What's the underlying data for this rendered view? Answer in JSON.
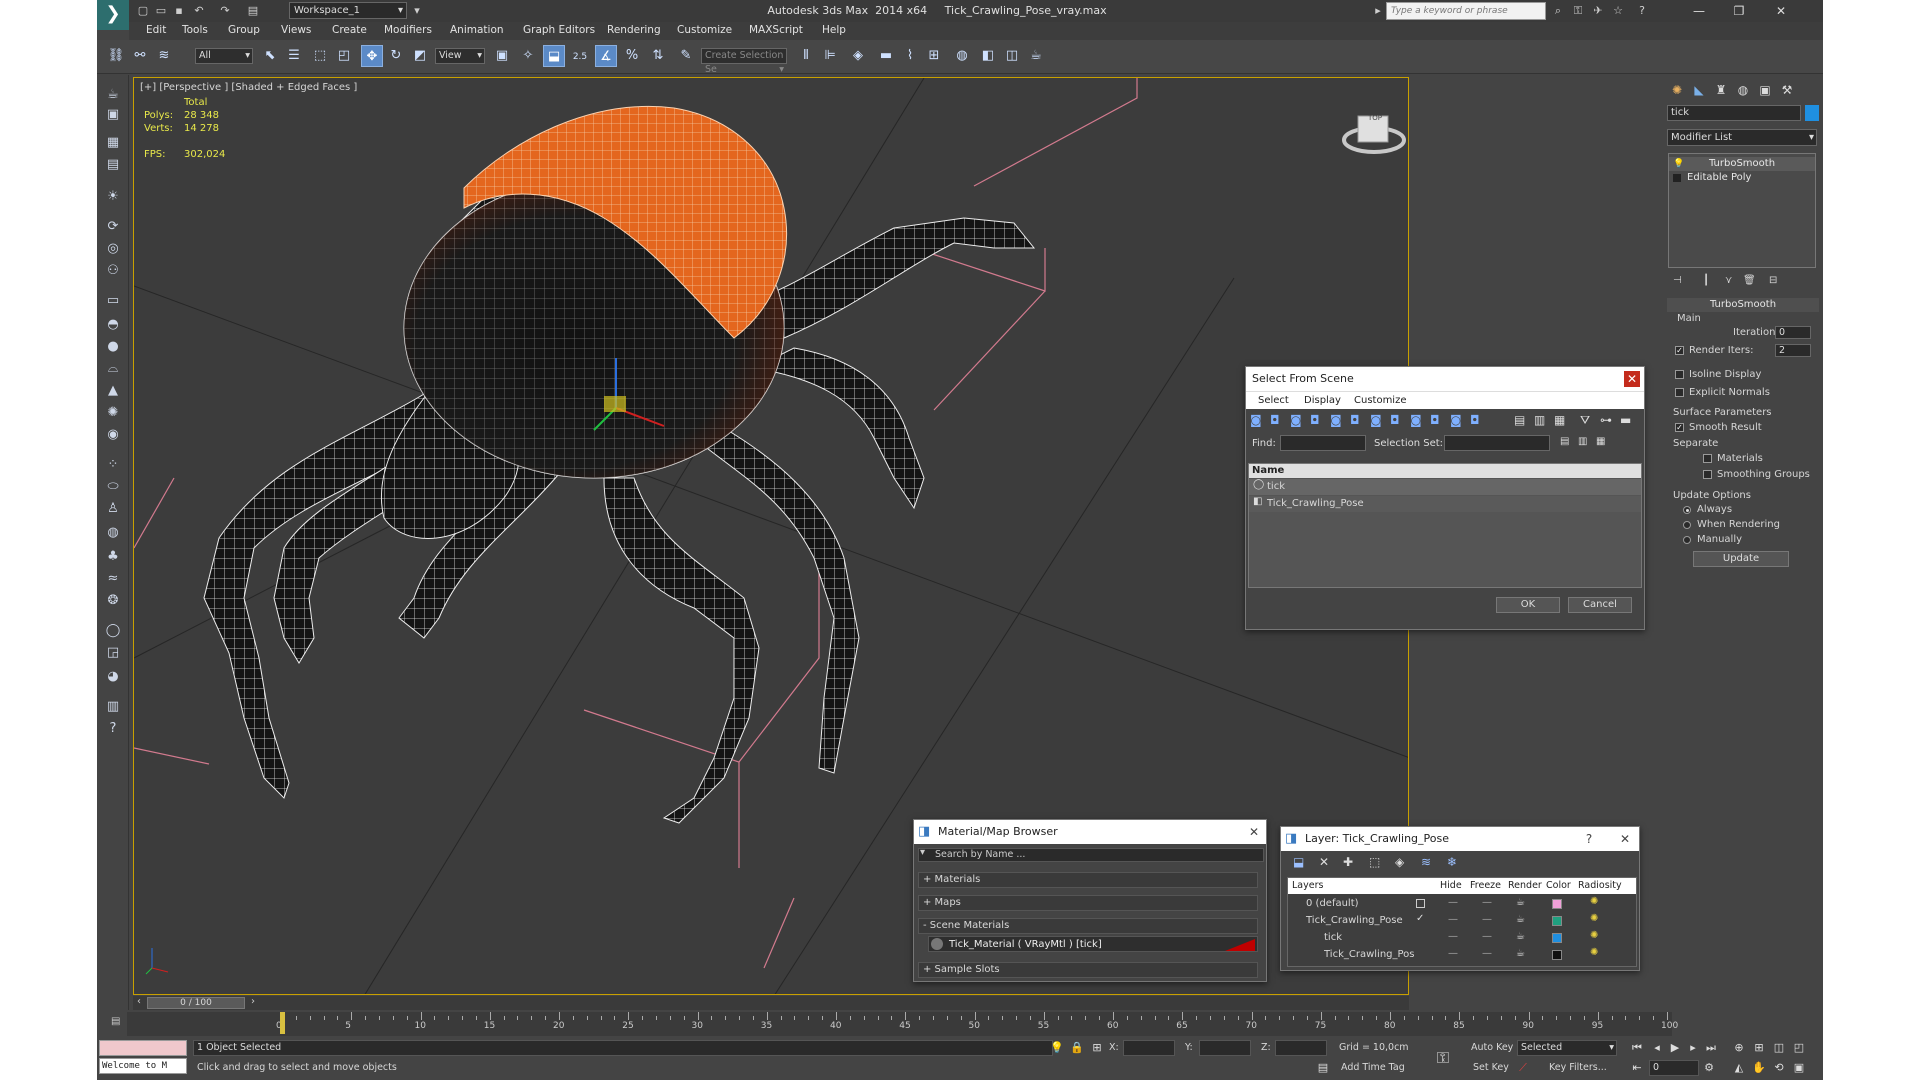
{
  "app": {
    "window_title": "Autodesk 3ds Max  2014 x64     Tick_Crawling_Pose_vray.max",
    "workspace": "Workspace_1",
    "search_placeholder": "Type a keyword or phrase"
  },
  "menu": [
    "Edit",
    "Tools",
    "Group",
    "Views",
    "Create",
    "Modifiers",
    "Animation",
    "Graph Editors",
    "Rendering",
    "Customize",
    "MAXScript",
    "Help"
  ],
  "toolbar": {
    "selection_filter": "All",
    "reference_coord": "View",
    "snap_value": "2.5",
    "named_selection_placeholder": "Create Selection Se"
  },
  "viewport": {
    "label": "[+] [Perspective ] [Shaded + Edged Faces ]",
    "stats": {
      "total_label": "Total",
      "polys_label": "Polys:",
      "polys_value": "28 348",
      "verts_label": "Verts:",
      "verts_value": "14 278",
      "fps_label": "FPS:",
      "fps_value": "302,024"
    },
    "viewcube_text": "TOP"
  },
  "command_panel": {
    "object_name": "tick",
    "object_color": "#1f8fe0",
    "modifier_list": "Modifier List",
    "stack": [
      "TurboSmooth",
      "Editable Poly"
    ],
    "turbosmooth": {
      "title": "TurboSmooth",
      "main": "Main",
      "iterations_label": "Iterations:",
      "iterations_value": "0",
      "render_iters_label": "Render Iters:",
      "render_iters_value": "2",
      "isoline": "Isoline Display",
      "explicit_normals": "Explicit Normals",
      "surface_params": "Surface Parameters",
      "smooth_result": "Smooth Result",
      "separate": "Separate",
      "materials": "Materials",
      "smoothing_groups": "Smoothing Groups",
      "update_options": "Update Options",
      "always": "Always",
      "when_rendering": "When Rendering",
      "manually": "Manually",
      "update_btn": "Update"
    }
  },
  "select_from_scene": {
    "title": "Select From Scene",
    "menu": [
      "Select",
      "Display",
      "Customize"
    ],
    "find_label": "Find:",
    "selection_set_label": "Selection Set:",
    "column_name": "Name",
    "rows": [
      "tick",
      "Tick_Crawling_Pose"
    ],
    "ok": "OK",
    "cancel": "Cancel"
  },
  "material_browser": {
    "title": "Material/Map Browser",
    "search_placeholder": "Search by Name ...",
    "groups": [
      "+ Materials",
      "+ Maps",
      "- Scene Materials",
      "+ Sample Slots"
    ],
    "scene_material": "Tick_Material  ( VRayMtl )  [tick]"
  },
  "layer_window": {
    "title": "Layer: Tick_Crawling_Pose",
    "help": "?",
    "columns": [
      "Layers",
      "Hide",
      "Freeze",
      "Render",
      "Color",
      "Radiosity"
    ],
    "rows": [
      {
        "name": "0 (default)",
        "color": "#f0a0d8"
      },
      {
        "name": "Tick_Crawling_Pose",
        "color": "#20a080"
      },
      {
        "name": "tick",
        "color": "#1f8fe0"
      },
      {
        "name": "Tick_Crawling_Pose",
        "color": "#111111"
      }
    ]
  },
  "timeline": {
    "frame": "0 / 100",
    "ticks": [
      "0",
      "5",
      "10",
      "15",
      "20",
      "25",
      "30",
      "35",
      "40",
      "45",
      "50",
      "55",
      "60",
      "65",
      "70",
      "75",
      "80",
      "85",
      "90",
      "95",
      "100"
    ]
  },
  "status": {
    "maxscript": "Welcome to M",
    "selection": "1 Object Selected",
    "prompt": "Click and drag to select and move objects",
    "x_label": "X:",
    "y_label": "Y:",
    "z_label": "Z:",
    "grid": "Grid = 10,0cm",
    "add_time_tag": "Add Time Tag",
    "auto_key": "Auto Key",
    "selected": "Selected",
    "set_key": "Set Key",
    "key_filters": "Key Filters...",
    "current_frame": "0"
  }
}
